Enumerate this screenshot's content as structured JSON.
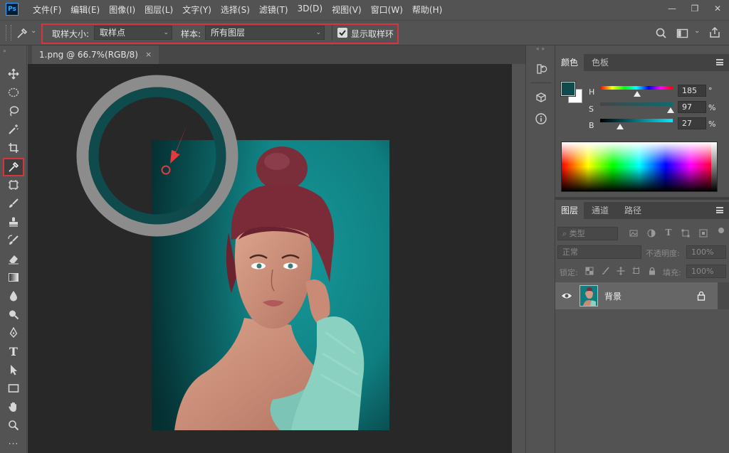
{
  "app": {
    "logo": "Ps",
    "accent": "#31a8ff"
  },
  "menu": [
    "文件(F)",
    "编辑(E)",
    "图像(I)",
    "图层(L)",
    "文字(Y)",
    "选择(S)",
    "滤镜(T)",
    "3D(D)",
    "视图(V)",
    "窗口(W)",
    "帮助(H)"
  ],
  "window_controls": {
    "minimize": "—",
    "restore": "❐",
    "close": "✕"
  },
  "options": {
    "sample_size_label": "取样大小:",
    "sample_size_value": "取样点",
    "sample_label": "样本:",
    "sample_value": "所有图层",
    "show_ring_label": "显示取样环",
    "show_ring_checked": true,
    "caret": "⌄",
    "highlight_color": "#d8343c"
  },
  "document": {
    "tab_title": "1.png @ 66.7%(RGB/8)",
    "close_glyph": "×"
  },
  "sample_ring": {
    "outer_color": "#8c8c8c",
    "sampled_color": "#0f4a4c"
  },
  "color_panel": {
    "tabs": [
      "颜色",
      "色板"
    ],
    "foreground": "#0f4a4c",
    "background": "#ffffff",
    "h_label": "H",
    "h_value": "185",
    "h_unit": "°",
    "s_label": "S",
    "s_value": "97",
    "s_unit": "%",
    "b_label": "B",
    "b_value": "27",
    "b_unit": "%",
    "h_fraction": 0.514,
    "s_fraction": 0.97,
    "b_fraction": 0.27
  },
  "layers_panel": {
    "tabs": [
      "图层",
      "通道",
      "路径"
    ],
    "filter_placeholder": "类型",
    "blend_mode": "正常",
    "opacity_label": "不透明度:",
    "opacity_value": "100%",
    "lock_label": "锁定:",
    "fill_label": "填充:",
    "fill_value": "100%",
    "layer_name": "背景"
  }
}
